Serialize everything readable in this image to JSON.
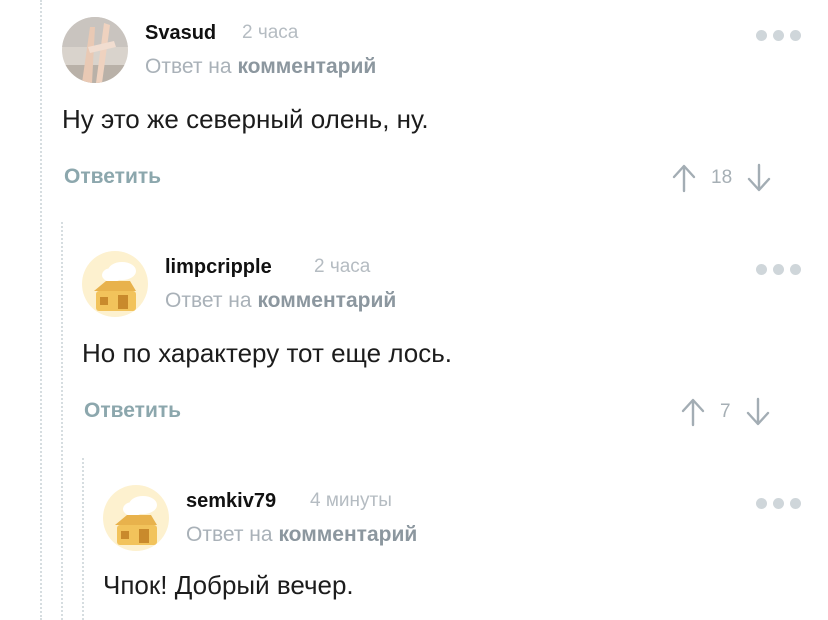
{
  "comments": [
    {
      "username": "Svasud",
      "time": "2 часа",
      "reply_prefix": "Ответ на",
      "reply_link": "комментарий",
      "text": "Ну это же северный олень, ну.",
      "reply_button": "Ответить",
      "score": "18",
      "avatar": "photo-avatar"
    },
    {
      "username": "limpcripple",
      "time": "2 часа",
      "reply_prefix": "Ответ на",
      "reply_link": "комментарий",
      "text": "Но по характеру тот еще лось.",
      "reply_button": "Ответить",
      "score": "7",
      "avatar": "house-avatar"
    },
    {
      "username": "semkiv79",
      "time": "4 минуты",
      "reply_prefix": "Ответ на",
      "reply_link": "комментарий",
      "text": "Чпок! Добрый вечер.",
      "avatar": "house-avatar"
    }
  ],
  "colors": {
    "accent": "#8ca7ad",
    "muted": "#a9b1b8",
    "thread_line": "#d6dde0"
  }
}
